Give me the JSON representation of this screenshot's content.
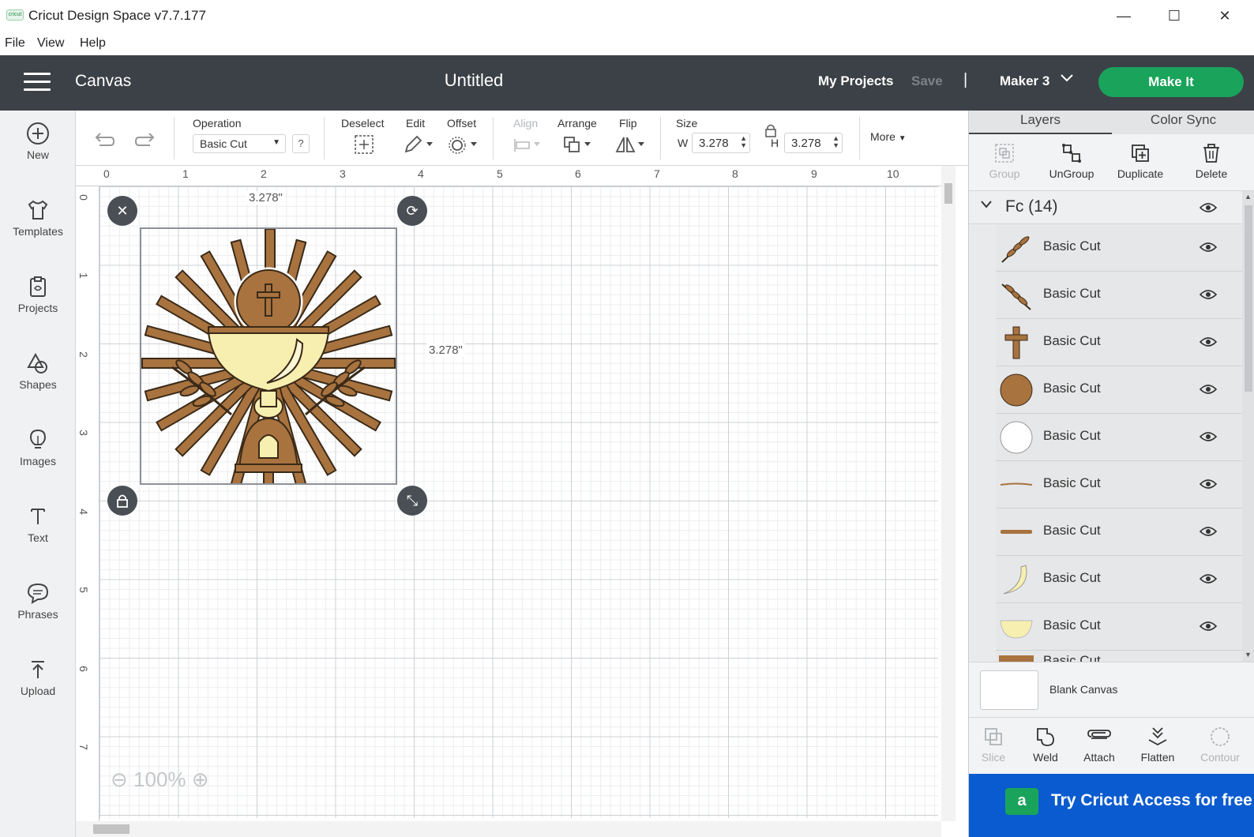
{
  "window": {
    "title": "Cricut Design Space  v7.7.177",
    "app_icon_text": "cricut",
    "controls": [
      "—",
      "☐",
      "✕"
    ]
  },
  "menu": [
    "File",
    "View",
    "Help"
  ],
  "header": {
    "section": "Canvas",
    "document_title": "Untitled",
    "my_projects": "My Projects",
    "save": "Save",
    "separator": "|",
    "machine": "Maker 3",
    "make_it": "Make It"
  },
  "sidebar": [
    {
      "label": "New",
      "icon": "plus-circle-icon"
    },
    {
      "label": "Templates",
      "icon": "tshirt-icon"
    },
    {
      "label": "Projects",
      "icon": "clipboard-icon"
    },
    {
      "label": "Shapes",
      "icon": "shapes-icon"
    },
    {
      "label": "Images",
      "icon": "lightbulb-icon"
    },
    {
      "label": "Text",
      "icon": "text-icon"
    },
    {
      "label": "Phrases",
      "icon": "speech-bubble-icon"
    },
    {
      "label": "Upload",
      "icon": "upload-icon"
    }
  ],
  "toolbar": {
    "operation_label": "Operation",
    "operation_value": "Basic Cut",
    "help": "?",
    "deselect": "Deselect",
    "edit": "Edit",
    "offset": "Offset",
    "align": "Align",
    "arrange": "Arrange",
    "flip": "Flip",
    "size": "Size",
    "w_label": "W",
    "w_value": "3.278",
    "h_label": "H",
    "h_value": "3.278",
    "more": "More"
  },
  "canvas": {
    "ruler_top": [
      "0",
      "1",
      "2",
      "3",
      "4",
      "5",
      "6",
      "7",
      "8",
      "9",
      "10"
    ],
    "ruler_left": [
      "0",
      "1",
      "2",
      "3",
      "4",
      "5",
      "6",
      "7"
    ],
    "width_label": "3.278\"",
    "height_label": "3.278\"",
    "zoom": "100%"
  },
  "layers_panel": {
    "tabs": [
      "Layers",
      "Color Sync"
    ],
    "actions": [
      "Group",
      "UnGroup",
      "Duplicate",
      "Delete"
    ],
    "group_name": "Fc (14)",
    "layers": [
      {
        "name": "Basic Cut",
        "thumb": "wheat-dark"
      },
      {
        "name": "Basic Cut",
        "thumb": "wheat-dark"
      },
      {
        "name": "Basic Cut",
        "thumb": "cross"
      },
      {
        "name": "Basic Cut",
        "thumb": "circle-brown"
      },
      {
        "name": "Basic Cut",
        "thumb": "circle-white"
      },
      {
        "name": "Basic Cut",
        "thumb": "line-thin"
      },
      {
        "name": "Basic Cut",
        "thumb": "line-thick"
      },
      {
        "name": "Basic Cut",
        "thumb": "crescent"
      },
      {
        "name": "Basic Cut",
        "thumb": "bowl"
      },
      {
        "name": "Basic Cut",
        "thumb": "bar"
      }
    ],
    "blank_canvas": "Blank Canvas",
    "bottom_actions": [
      "Slice",
      "Weld",
      "Attach",
      "Flatten",
      "Contour"
    ],
    "promo": "Try Cricut Access for free",
    "promo_logo": "a"
  },
  "colors": {
    "header_bg": "#3c4147",
    "make_it": "#1aa35a",
    "promo_bg": "#0a5bcf",
    "brown": "#a8733f",
    "cream": "#f7efb0"
  }
}
